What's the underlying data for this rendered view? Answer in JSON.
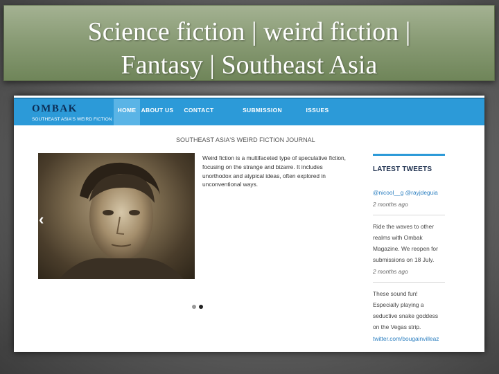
{
  "slide_title": {
    "line1": "Science fiction | weird fiction |",
    "line2": "Fantasy | Southeast Asia"
  },
  "site": {
    "logo": "OMBAK",
    "tagline": "SOUTHEAST ASIA'S WEIRD FICTION JOURNAL"
  },
  "nav": {
    "items": [
      {
        "label": "HOME",
        "active": true
      },
      {
        "label": "ABOUT US",
        "active": false
      },
      {
        "label": "CONTACT US",
        "active": false
      },
      {
        "label": "SUBMISSION INFORMATION",
        "active": false
      },
      {
        "label": "ISSUES",
        "active": false
      }
    ]
  },
  "main": {
    "heading": "SOUTHEAST ASIA'S WEIRD FICTION JOURNAL",
    "intro_lines": [
      "Weird fiction is a multifaceted type of speculative fiction,",
      "focusing on the strange and bizarre. It includes",
      "unorthodox and atypical ideas, often explored in",
      "unconventional ways."
    ],
    "slider_prev_glyph": "‹",
    "slider": {
      "current": 2,
      "total": 2
    }
  },
  "sidebar": {
    "title": "LATEST TWEETS",
    "tweets": [
      {
        "lines": [
          "@nicool__g @rayjdeguia"
        ],
        "time": "2 months ago"
      },
      {
        "lines": [
          "Ride the waves to other",
          "realms with Ombak",
          "Magazine. We reopen for",
          "submissions on 18 July."
        ],
        "time": "2 months ago"
      },
      {
        "lines": [
          "These sound fun!",
          "Especially playing a",
          "seductive snake goddess",
          "on the Vegas strip."
        ],
        "link": "twitter.com/bougainvilleaz"
      }
    ]
  },
  "colors": {
    "nav_blue": "#2c9ad8",
    "nav_active": "#5ab4e6",
    "title_green": "#8a9c76",
    "link_blue": "#2c7fc0"
  },
  "icons": {
    "slider_prev": "chevron-left-icon",
    "hero": "portrait-photo"
  }
}
